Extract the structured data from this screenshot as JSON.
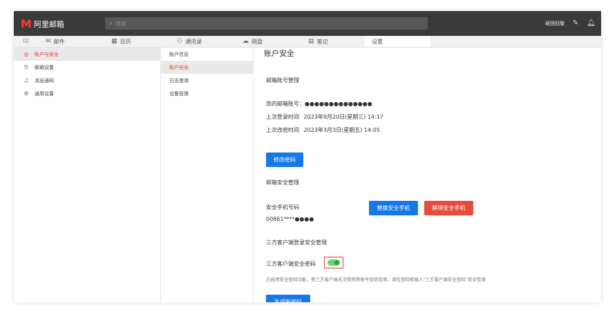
{
  "app": {
    "logo_mark": "M",
    "logo_text": "阿里邮箱"
  },
  "search": {
    "placeholder": "搜索"
  },
  "header": {
    "back_label": "返回旧版"
  },
  "tabs": [
    {
      "label": "",
      "icon": "grid-icon"
    },
    {
      "label": "邮件",
      "icon": "mail-icon"
    },
    {
      "label": "日历",
      "icon": "calendar-icon"
    },
    {
      "label": "通讯录",
      "icon": "contacts-icon"
    },
    {
      "label": "网盘",
      "icon": "cloud-icon"
    },
    {
      "label": "笔记",
      "icon": "note-icon"
    },
    {
      "label": "设置",
      "icon": ""
    }
  ],
  "sidebar": {
    "items": [
      {
        "label": "账户与安全",
        "icon": "user-icon"
      },
      {
        "label": "邮箱设置",
        "icon": "mailbox-icon"
      },
      {
        "label": "消息通知",
        "icon": "bell-icon"
      },
      {
        "label": "通用设置",
        "icon": "gear-icon"
      }
    ]
  },
  "subnav": {
    "items": [
      "账户信息",
      "账户安全",
      "日志查询",
      "设备管理"
    ]
  },
  "content": {
    "title": "账户安全",
    "account_section": "邮箱账号管理",
    "account_label": "您的邮箱账号：",
    "account_value": "●●●●●●●●●●●●●●",
    "last_login_label": "上次登录时间",
    "last_login_value": "2023年9月20日(星期三) 14:17",
    "last_pwd_label": "上次改密时间",
    "last_pwd_value": "2023年3月3日(星期五) 14:05",
    "change_pwd_button": "修改密码",
    "security_section": "邮箱安全管理",
    "phone_label": "安全手机号码",
    "phone_value": "00861****●●●●",
    "replace_phone_button": "替换安全手机",
    "unbind_phone_button": "解绑安全手机",
    "client_section": "三方客户端登录安全管理",
    "client_pwd_label": "三方客户端安全密码",
    "client_pwd_enabled": true,
    "note": "已启用安全密码功能，第三方客户端无法使用原账号密码登录，请在密码框输入\"三方客户端安全密码\"验证登录",
    "generate_button": "生成新密码"
  },
  "colors": {
    "accent": "#1677e8",
    "danger": "#e84a3c",
    "active_text": "#e03c31",
    "toggle_on": "#2eaa34"
  }
}
